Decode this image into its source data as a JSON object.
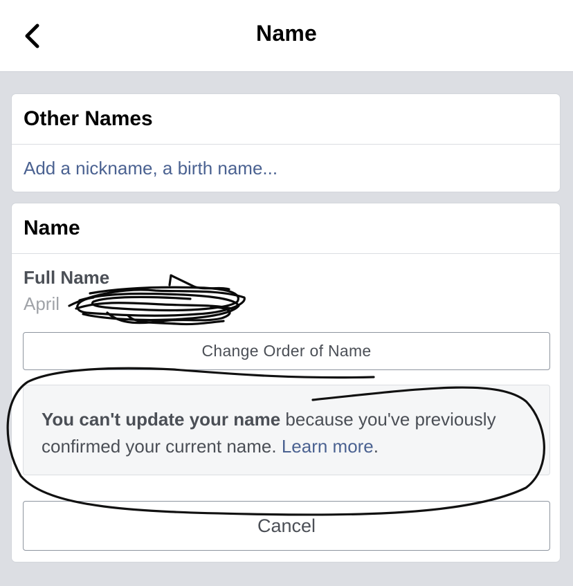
{
  "header": {
    "title": "Name",
    "back_icon": "chevron-left-icon"
  },
  "other_names": {
    "heading": "Other Names",
    "add_link": "Add a nickname, a birth name..."
  },
  "name_section": {
    "heading": "Name",
    "full_name_label": "Full Name",
    "full_name_value": "April",
    "change_order_label": "Change Order of Name",
    "notice": {
      "bold": "You can't update your name",
      "text": " because you've previously confirmed your current name. ",
      "link": "Learn more",
      "end": "."
    },
    "cancel_label": "Cancel"
  },
  "colors": {
    "link": "#4b6291",
    "background": "#dcdee3",
    "annotation_ink": "#111111"
  }
}
